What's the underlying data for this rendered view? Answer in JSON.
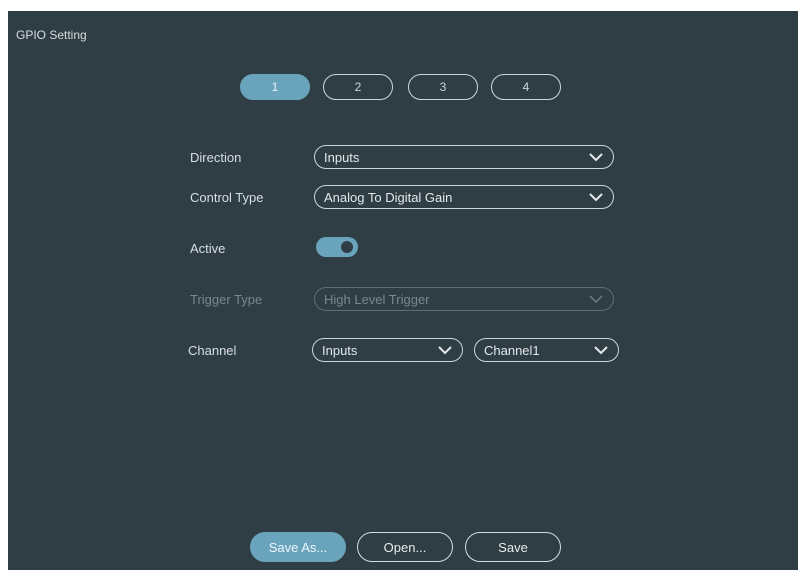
{
  "panel": {
    "title": "GPIO Setting"
  },
  "tabs": [
    {
      "label": "1",
      "active": true
    },
    {
      "label": "2",
      "active": false
    },
    {
      "label": "3",
      "active": false
    },
    {
      "label": "4",
      "active": false
    }
  ],
  "form": {
    "direction": {
      "label": "Direction",
      "value": "Inputs"
    },
    "control_type": {
      "label": "Control Type",
      "value": "Analog To Digital Gain"
    },
    "active": {
      "label": "Active",
      "on": true
    },
    "trigger_type": {
      "label": "Trigger Type",
      "value": "High Level Trigger",
      "disabled": true
    },
    "channel": {
      "label": "Channel",
      "source_value": "Inputs",
      "channel_value": "Channel1"
    }
  },
  "buttons": {
    "save_as": "Save As...",
    "open": "Open...",
    "save": "Save"
  },
  "colors": {
    "panel_bg": "#2f3e44",
    "accent": "#6aa4bc",
    "outline": "#cfd6d9"
  }
}
